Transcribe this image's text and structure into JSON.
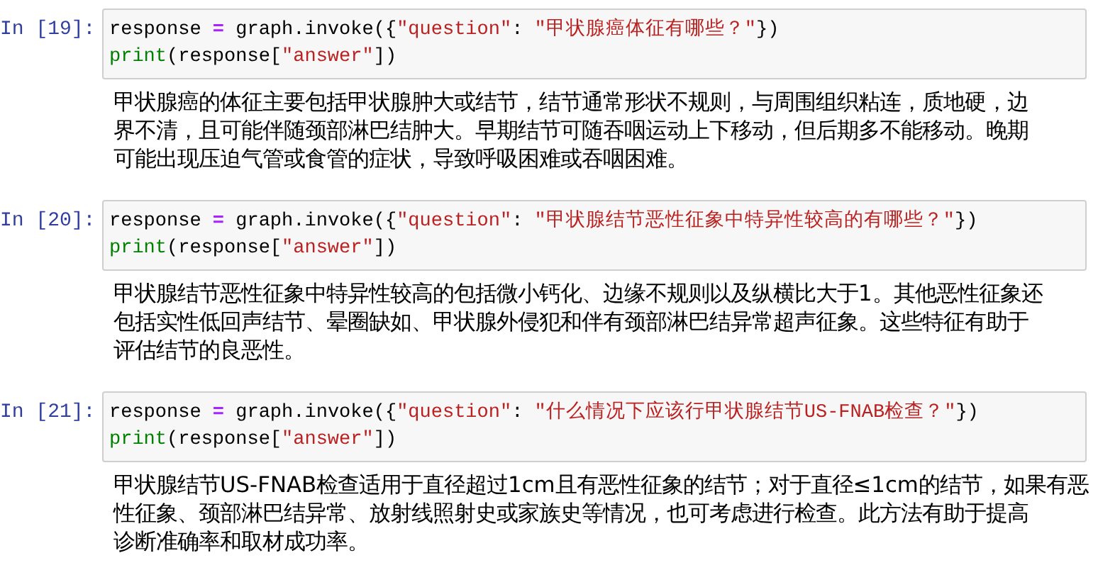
{
  "cells": [
    {
      "prompt": "In [19]:",
      "code_lines": [
        [
          {
            "kind": "name",
            "text": "response "
          },
          {
            "kind": "operator",
            "text": "="
          },
          {
            "kind": "name",
            "text": " graph.invoke({"
          },
          {
            "kind": "string",
            "text": "\"question\""
          },
          {
            "kind": "name",
            "text": ": "
          },
          {
            "kind": "string",
            "text": "\"甲状腺癌体征有哪些？\""
          },
          {
            "kind": "name",
            "text": "})"
          }
        ],
        [
          {
            "kind": "builtin",
            "text": "print"
          },
          {
            "kind": "name",
            "text": "(response["
          },
          {
            "kind": "string",
            "text": "\"answer\""
          },
          {
            "kind": "name",
            "text": "])"
          }
        ]
      ],
      "output_lines": [
        "甲状腺癌的体征主要包括甲状腺肿大或结节，结节通常形状不规则，与周围组织粘连，质地硬，边",
        "界不清，且可能伴随颈部淋巴结肿大。早期结节可随吞咽运动上下移动，但后期多不能移动。晚期",
        "可能出现压迫气管或食管的症状，导致呼吸困难或吞咽困难。"
      ]
    },
    {
      "prompt": "In [20]:",
      "code_lines": [
        [
          {
            "kind": "name",
            "text": "response "
          },
          {
            "kind": "operator",
            "text": "="
          },
          {
            "kind": "name",
            "text": " graph.invoke({"
          },
          {
            "kind": "string",
            "text": "\"question\""
          },
          {
            "kind": "name",
            "text": ": "
          },
          {
            "kind": "string",
            "text": "\"甲状腺结节恶性征象中特异性较高的有哪些？\""
          },
          {
            "kind": "name",
            "text": "})"
          }
        ],
        [
          {
            "kind": "builtin",
            "text": "print"
          },
          {
            "kind": "name",
            "text": "(response["
          },
          {
            "kind": "string",
            "text": "\"answer\""
          },
          {
            "kind": "name",
            "text": "])"
          }
        ]
      ],
      "output_lines": [
        "甲状腺结节恶性征象中特异性较高的包括微小钙化、边缘不规则以及纵横比大于1。其他恶性征象还",
        "包括实性低回声结节、晕圈缺如、甲状腺外侵犯和伴有颈部淋巴结异常超声征象。这些特征有助于",
        "评估结节的良恶性。"
      ]
    },
    {
      "prompt": "In [21]:",
      "code_lines": [
        [
          {
            "kind": "name",
            "text": "response "
          },
          {
            "kind": "operator",
            "text": "="
          },
          {
            "kind": "name",
            "text": " graph.invoke({"
          },
          {
            "kind": "string",
            "text": "\"question\""
          },
          {
            "kind": "name",
            "text": ": "
          },
          {
            "kind": "string",
            "text": "\"什么情况下应该行甲状腺结节US-FNAB检查？\""
          },
          {
            "kind": "name",
            "text": "})"
          }
        ],
        [
          {
            "kind": "builtin",
            "text": "print"
          },
          {
            "kind": "name",
            "text": "(response["
          },
          {
            "kind": "string",
            "text": "\"answer\""
          },
          {
            "kind": "name",
            "text": "])"
          }
        ]
      ],
      "output_lines": [
        "甲状腺结节US-FNAB检查适用于直径超过1cm且有恶性征象的结节；对于直径≤1cm的结节，如果有恶",
        "性征象、颈部淋巴结异常、放射线照射史或家族史等情况，也可考虑进行检查。此方法有助于提高",
        "诊断准确率和取材成功率。"
      ]
    }
  ]
}
